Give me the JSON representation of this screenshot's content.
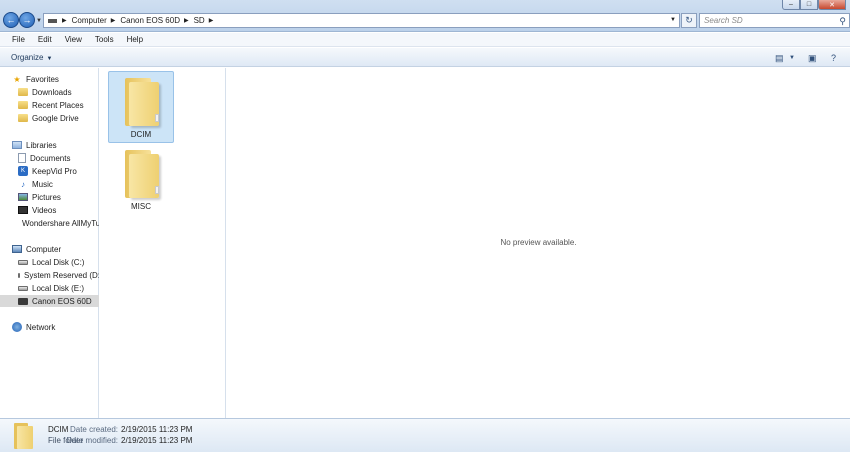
{
  "address": {
    "breadcrumbs": [
      "Computer",
      "Canon EOS 60D",
      "SD"
    ],
    "search_placeholder": "Search SD"
  },
  "window_controls": {
    "minimize": "–",
    "maximize": "□",
    "close": "✕"
  },
  "menu": [
    "File",
    "Edit",
    "View",
    "Tools",
    "Help"
  ],
  "toolbar": {
    "organize_label": "Organize"
  },
  "nav": {
    "favorites": {
      "label": "Favorites",
      "items": [
        "Downloads",
        "Recent Places",
        "Google Drive"
      ]
    },
    "libraries": {
      "label": "Libraries",
      "items": [
        "Documents",
        "KeepVid Pro",
        "Music",
        "Pictures",
        "Videos",
        "Wondershare AllMyTube"
      ]
    },
    "computer": {
      "label": "Computer",
      "items": [
        "Local Disk (C:)",
        "System Reserved (D:)",
        "Local Disk (E:)",
        "Canon EOS 60D"
      ],
      "selected": "Canon EOS 60D"
    },
    "network": {
      "label": "Network"
    }
  },
  "files": [
    {
      "name": "DCIM",
      "selected": true
    },
    {
      "name": "MISC",
      "selected": false
    }
  ],
  "preview": {
    "message": "No preview available."
  },
  "details": {
    "name": "DCIM",
    "type": "File folder",
    "date_created_label": "Date created:",
    "date_created": "2/19/2015 11:23 PM",
    "date_modified_label": "Date modified:",
    "date_modified": "2/19/2015 11:23 PM"
  }
}
